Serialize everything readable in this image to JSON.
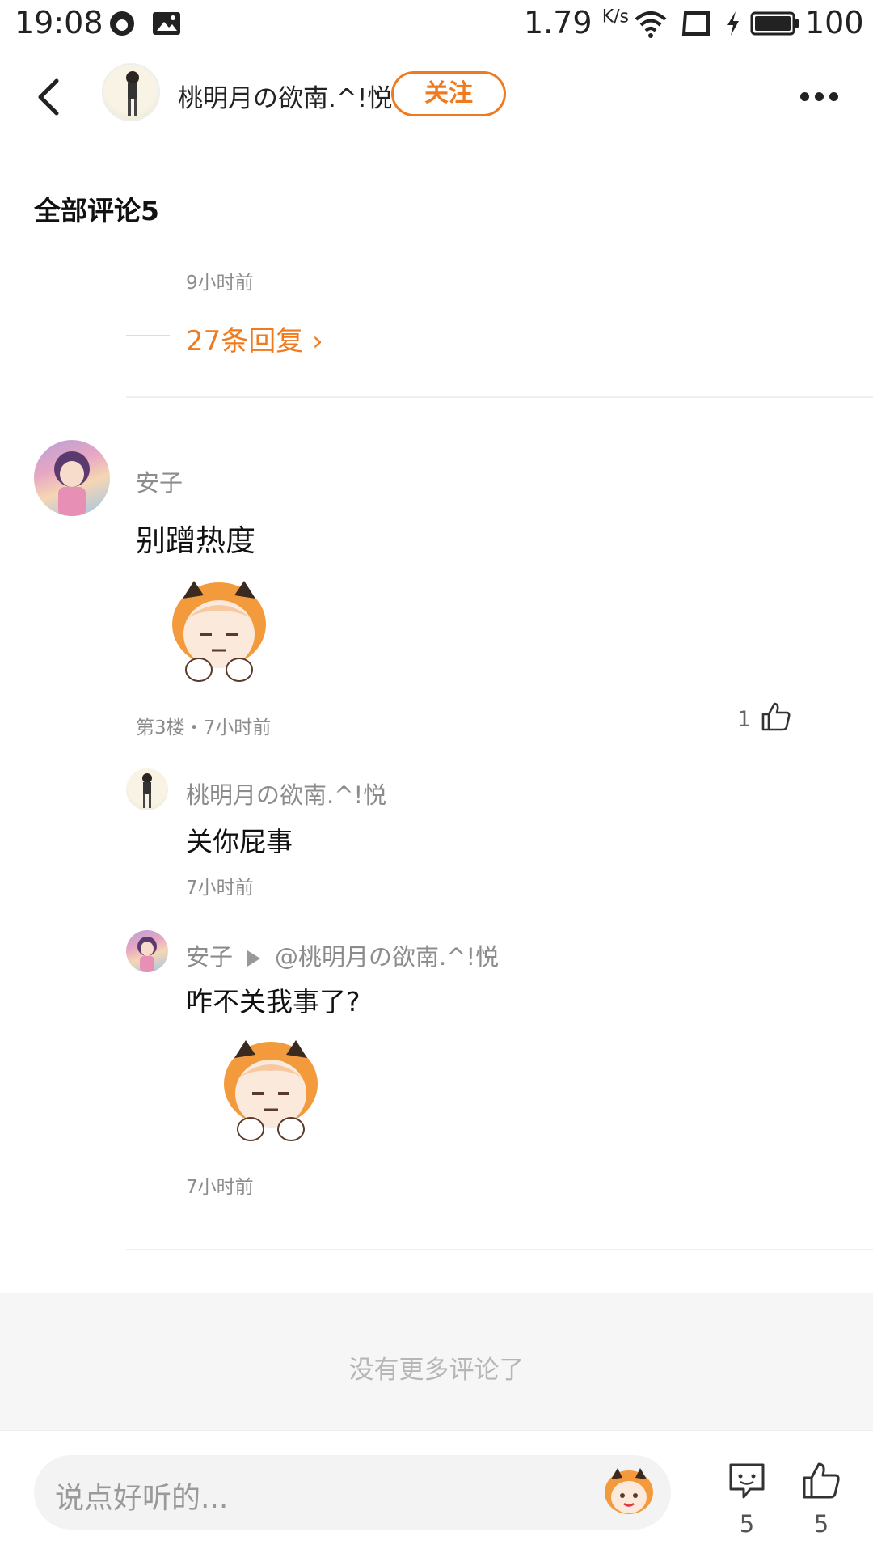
{
  "status_bar": {
    "time": "19:08",
    "speed": "1.79",
    "speed_unit": "K/s",
    "battery": "100"
  },
  "header": {
    "username": "桃明月の欲南.^!悦",
    "follow_label": "关注"
  },
  "comments_header": {
    "title": "全部评论5"
  },
  "previous_comment": {
    "time": "9小时前",
    "replies_label": "27条回复"
  },
  "comment": {
    "username": "安子",
    "text": "别蹭热度",
    "meta": "第3楼・7小时前",
    "likes": "1"
  },
  "replies": [
    {
      "username": "桃明月の欲南.^!悦",
      "text": "关你屁事",
      "time": "7小时前"
    },
    {
      "username": "安子",
      "reply_to": "@桃明月の欲南.^!悦",
      "text": "咋不关我事了?",
      "time": "7小时前"
    }
  ],
  "footer": {
    "no_more": "没有更多评论了"
  },
  "bottom_bar": {
    "input_placeholder": "说点好听的...",
    "comment_count": "5",
    "like_count": "5"
  },
  "colors": {
    "accent": "#f07a1e",
    "secondary_text": "#8c8c8c",
    "band": "#f6f6f6"
  },
  "icons": [
    "back-arrow-icon",
    "more-icon",
    "thumbs-up-icon",
    "comment-icon",
    "emoji-icon",
    "wifi-icon",
    "battery-icon",
    "charging-icon"
  ]
}
